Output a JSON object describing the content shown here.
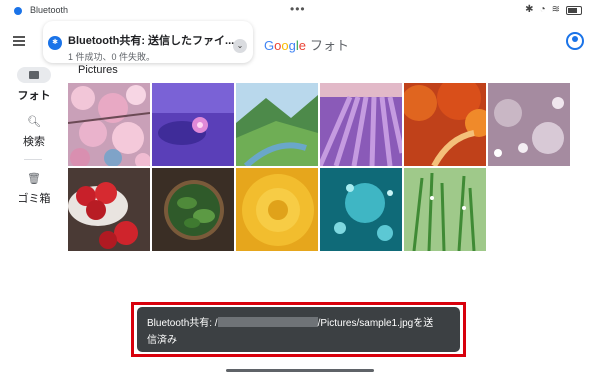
{
  "status_bar": {
    "app_title": "Bluetooth",
    "center_indicator": "•••"
  },
  "app_bar": {
    "logo_google": [
      "G",
      "o",
      "o",
      "g",
      "l",
      "e"
    ],
    "logo_photos": "フォト"
  },
  "notification": {
    "title": "Bluetooth共有: 送信したファイ...",
    "subtitle": "1 件成功、0 件失敗。"
  },
  "nav": {
    "photos_label": "フォト",
    "search_label": "検索",
    "trash_label": "ゴミ箱"
  },
  "album": {
    "title": "Pictures"
  },
  "toast": {
    "prefix": "Bluetooth共有: /",
    "path_suffix": "/Pictures/sample1.jpgを送",
    "line2": "信済み"
  },
  "icons": {
    "menu": "hamburger-icon",
    "account": "account-circle-icon",
    "bluetooth": "bluetooth-icon",
    "search": "search-icon",
    "trash": "trash-icon"
  }
}
